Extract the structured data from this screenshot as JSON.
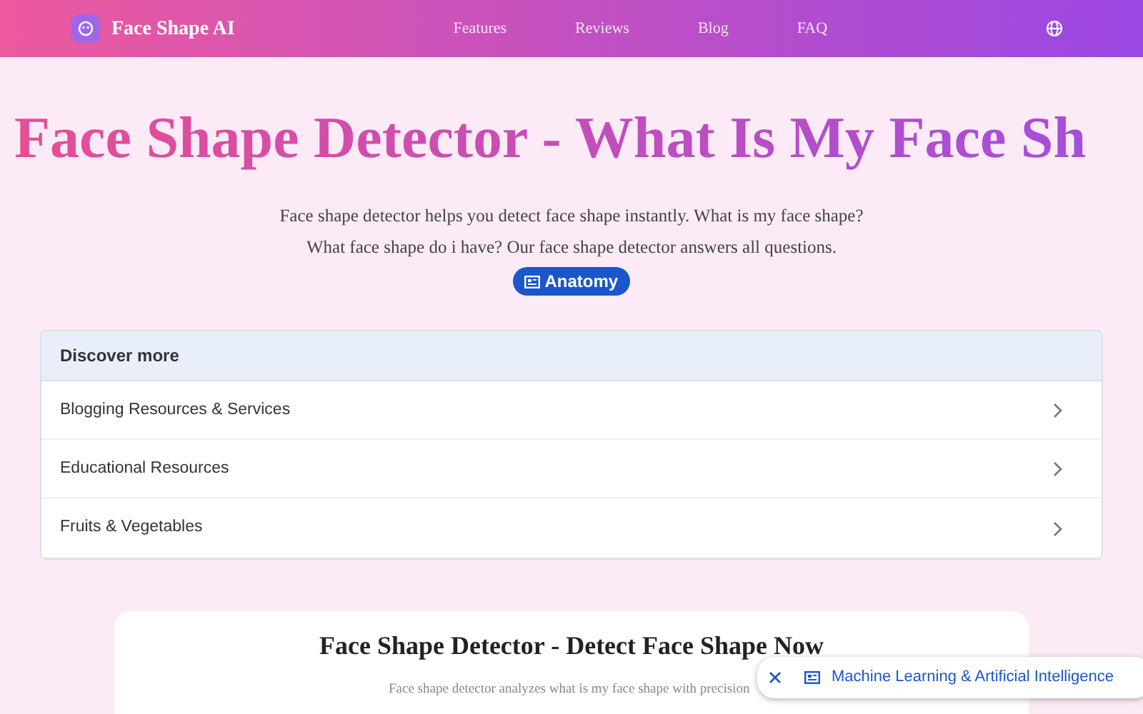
{
  "navbar": {
    "brand": "Face Shape AI",
    "links": [
      "Features",
      "Reviews",
      "Blog",
      "FAQ"
    ]
  },
  "hero": {
    "title": "Face Shape Detector - What Is My Face Sh",
    "lines": [
      "Face shape detector helps you detect face shape instantly. What is my face shape?",
      "What face shape do i have? Our face shape detector answers all questions."
    ],
    "chip": "Anatomy"
  },
  "discover": {
    "heading": "Discover more",
    "items": [
      "Blogging Resources & Services",
      "Educational Resources",
      "Fruits & Vegetables"
    ]
  },
  "section": {
    "title": "Face Shape Detector - Detect Face Shape Now",
    "subtitle": "Face shape detector analyzes what is my face shape with precision"
  },
  "floating_chip": {
    "label": "Machine Learning & Artificial Intelligence"
  }
}
